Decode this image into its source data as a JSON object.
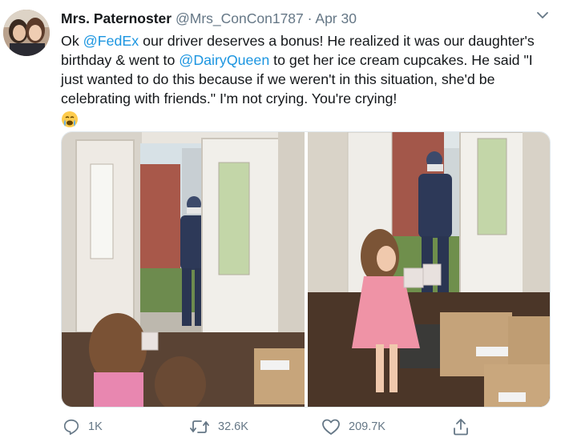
{
  "tweet": {
    "author_name": "Mrs. Paternoster",
    "handle": "@Mrs_ConCon1787",
    "separator": "·",
    "date": "Apr 30",
    "text_part1": "Ok ",
    "mention1": "@FedEx",
    "text_part2": " our driver deserves a bonus!  He realized it was our daughter's birthday & went to ",
    "mention2": "@DairyQueen",
    "text_part3": " to get her ice cream cupcakes. He said \"I just wanted to do this because if we weren't in this situation, she'd be celebrating with friends.\" I'm not crying. You're crying!",
    "emoji_icon": "crying-face-emoji"
  },
  "actions": {
    "reply_count": "1K",
    "retweet_count": "32.6K",
    "like_count": "209.7K"
  },
  "colors": {
    "mention": "#1b95e0",
    "muted": "#657786"
  }
}
